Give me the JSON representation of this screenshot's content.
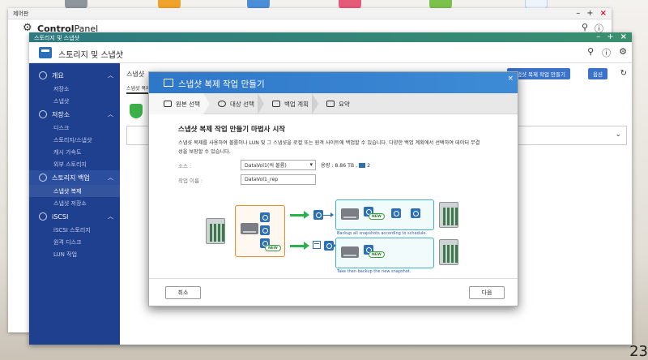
{
  "outer_window": {
    "title": "제어판",
    "app_name_bold": "Control",
    "app_name_light": "Panel"
  },
  "storage_window": {
    "titlebar": "스토리지 및 스냅샷",
    "header_title": "스토리지 및 스냅샷",
    "crumb": "스냅샷",
    "crumb2": "스냅샷 복제",
    "btn_create": "스냅샷 복제 작업 만들기",
    "btn_options": "옵션"
  },
  "sidebar": {
    "groups": [
      {
        "label": "개요",
        "items": [
          "저장소",
          "스냅샷"
        ]
      },
      {
        "label": "저장소",
        "items": [
          "디스크",
          "스토리지/스냅샷",
          "캐시 가속도",
          "외부 스토리지"
        ]
      },
      {
        "label": "스토리지 백업",
        "items": [
          "스냅샷 복제",
          "스냅샷 저장소"
        ]
      },
      {
        "label": "iSCSI",
        "items": [
          "iSCSI 스토리지",
          "원격 디스크",
          "LUN 작업"
        ]
      }
    ]
  },
  "dialog": {
    "title": "스냅샷 복제 작업 만들기",
    "steps": [
      "원본 선택",
      "대상 선택",
      "백업 계획",
      "요약"
    ],
    "heading": "스냅샷 복제 작업 만들기 마법사 시작",
    "desc_line1": "스냅샷 복제를 사용하여 볼륨이나 LUN 및 그 스냅샷을 로컬 또는 원격 사이트에 백업할 수 있습니다. 다양한 백업 계획에서 선택하여 데이터 무결",
    "desc_line2": "성을 보장할 수 있습니다.",
    "source_label": "소스 :",
    "source_value": "DataVol1(씩 볼륨)",
    "capacity": "용량 : 8.86 TB ,",
    "snapshot_count": "2",
    "job_label": "작업 이름 :",
    "job_value": "DataVol1_rep",
    "caption_top": "Backup all snapshots according to schedule.",
    "caption_bottom": "Take then backup the new snapshot.",
    "new_badge": "NEW",
    "btn_cancel": "취소",
    "btn_next": "다음"
  },
  "corner_text": "23",
  "colors": {
    "accent": "#2f77c9",
    "sidebar": "#1f3f8f",
    "orange": "#f28a2b",
    "teal": "#3fb4c8",
    "green": "#2bb24c"
  }
}
